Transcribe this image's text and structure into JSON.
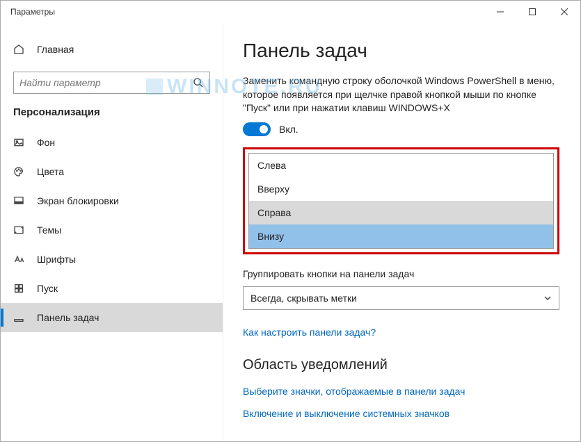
{
  "window": {
    "title": "Параметры"
  },
  "sidebar": {
    "home": "Главная",
    "search_placeholder": "Найти параметр",
    "section": "Персонализация",
    "items": [
      {
        "label": "Фон"
      },
      {
        "label": "Цвета"
      },
      {
        "label": "Экран блокировки"
      },
      {
        "label": "Темы"
      },
      {
        "label": "Шрифты"
      },
      {
        "label": "Пуск"
      },
      {
        "label": "Панель задач"
      }
    ]
  },
  "main": {
    "heading": "Панель задач",
    "powershell_desc": "Заменить командную строку оболочкой Windows PowerShell в меню, которое появляется при щелчке правой кнопкой мыши по кнопке \"Пуск\" или при нажатии клавиш WINDOWS+X",
    "toggle_state": "Вкл.",
    "position_options": [
      "Слева",
      "Вверху",
      "Справа",
      "Внизу"
    ],
    "group_label": "Группировать кнопки на панели задач",
    "group_value": "Всегда, скрывать метки",
    "howto_link": "Как настроить панели задач?",
    "notif_heading": "Область уведомлений",
    "notif_link1": "Выберите значки, отображаемые в панели задач",
    "notif_link2": "Включение и выключение системных значков"
  },
  "watermark": "WINNOTE.RU"
}
